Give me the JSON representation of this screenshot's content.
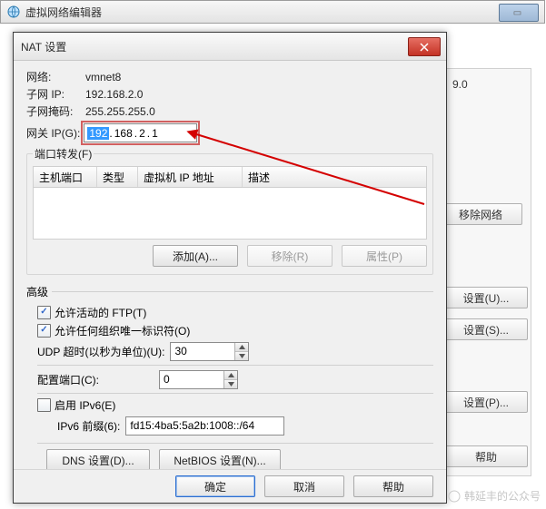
{
  "parent": {
    "title": "虚拟网络编辑器"
  },
  "bg": {
    "visible_value": "9.0",
    "remove_network": "移除网络",
    "settings_u": "设置(U)...",
    "settings_s": "设置(S)...",
    "settings_p": "设置(P)...",
    "help": "帮助"
  },
  "dialog": {
    "title": "NAT 设置",
    "network_label": "网络:",
    "network_value": "vmnet8",
    "subnet_ip_label": "子网 IP:",
    "subnet_ip_value": "192.168.2.0",
    "subnet_mask_label": "子网掩码:",
    "subnet_mask_value": "255.255.255.0",
    "gateway_label": "网关 IP(G):",
    "gateway_oct1": "192",
    "gateway_oct2": "168",
    "gateway_oct3": "2",
    "gateway_oct4": "1",
    "forwarding_legend": "端口转发(F)",
    "columns": {
      "c1": "主机端口",
      "c2": "类型",
      "c3": "虚拟机 IP 地址",
      "c4": "描述"
    },
    "add": "添加(A)...",
    "remove": "移除(R)",
    "properties": "属性(P)",
    "advanced_label": "高级",
    "allow_ftp": "允许活动的 FTP(T)",
    "allow_oui": "允许任何组织唯一标识符(O)",
    "udp_label": "UDP 超时(以秒为单位)(U):",
    "udp_value": "30",
    "cfg_port_label": "配置端口(C):",
    "cfg_port_value": "0",
    "enable_ipv6": "启用 IPv6(E)",
    "ipv6_prefix_label": "IPv6 前缀(6):",
    "ipv6_prefix_value": "fd15:4ba5:5a2b:1008::/64",
    "dns": "DNS 设置(D)...",
    "netbios": "NetBIOS 设置(N)...",
    "ok": "确定",
    "cancel": "取消",
    "help": "帮助"
  },
  "watermark": "韩延丰的公众号"
}
